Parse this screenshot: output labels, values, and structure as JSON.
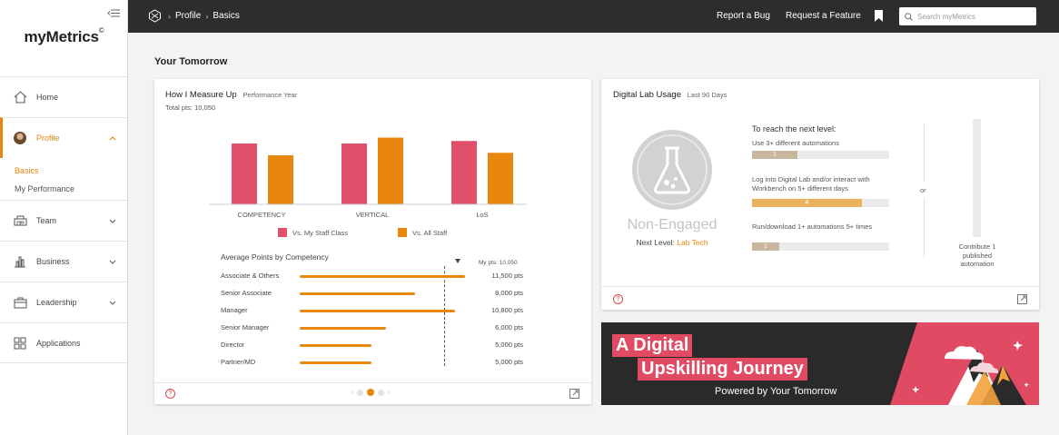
{
  "app": {
    "brand": "myMetrics",
    "brand_mark": "©"
  },
  "sidebar": {
    "collapse_icon": "collapse-menu-icon",
    "items": [
      {
        "label": "Home",
        "icon": "home-icon"
      },
      {
        "label": "Profile",
        "icon": "avatar"
      },
      {
        "label": "Team",
        "icon": "team-icon"
      },
      {
        "label": "Business",
        "icon": "chart-icon"
      },
      {
        "label": "Leadership",
        "icon": "briefcase-icon"
      },
      {
        "label": "Applications",
        "icon": "grid-icon"
      }
    ],
    "sub_items": [
      "Basics",
      "My Performance"
    ]
  },
  "topbar": {
    "breadcrumbs": [
      "Profile",
      "Basics"
    ],
    "report_bug": "Report a Bug",
    "request_feature": "Request a Feature",
    "search_placeholder": "Search myMetrics"
  },
  "page": {
    "title": "Your Tomorrow"
  },
  "measure_card": {
    "title": "How I Measure Up",
    "subtitle": "Performance Year",
    "total": "Total pts: 10,050",
    "legend": [
      "Vs. My Staff Class",
      "Vs. All Staff"
    ],
    "competency_title": "Average Points by Competency",
    "my_pts_label": "My pts: 10,050",
    "my_pts_value": 10050,
    "rows": [
      {
        "label": "Associate & Others",
        "value_text": "11,500 pts",
        "value": 11500
      },
      {
        "label": "Senior Associate",
        "value_text": "8,000 pts",
        "value": 8000
      },
      {
        "label": "Manager",
        "value_text": "10,800 pts",
        "value": 10800
      },
      {
        "label": "Senior Manager",
        "value_text": "6,000 pts",
        "value": 6000
      },
      {
        "label": "Director",
        "value_text": "5,000 pts",
        "value": 5000
      },
      {
        "label": "Partner/MD",
        "value_text": "5,000 pts",
        "value": 5000
      }
    ],
    "pager_prev": "‹",
    "pager_next": "›"
  },
  "chart_data": {
    "type": "bar",
    "categories": [
      "COMPETENCY",
      "VERTICAL",
      "LoS"
    ],
    "series": [
      {
        "name": "Vs. My Staff Class",
        "color": "#e0506a",
        "values": [
          72,
          72,
          75
        ]
      },
      {
        "name": "Vs. All Staff",
        "color": "#e8860d",
        "values": [
          58,
          79,
          61
        ]
      }
    ],
    "ylim": [
      0,
      100
    ],
    "grid": false,
    "legend": "bottom"
  },
  "lab_card": {
    "title": "Digital Lab Usage",
    "subtitle": "Last 90 Days",
    "status": "Non-Engaged",
    "next_level_label": "Next Level: ",
    "next_level_value": "Lab Tech",
    "reach_title": "To reach the next level:",
    "requirements": [
      {
        "text": "Use 3+ different automations",
        "value": "1",
        "fraction": 0.33,
        "color": "#c8b79e"
      },
      {
        "text": "Log into Digital Lab and/or interact with Workbench on 5+ different days",
        "value": "4",
        "fraction": 0.8,
        "color": "#e9b25e"
      },
      {
        "text": "Run/download 1+ automations 5+ times",
        "value": "1",
        "fraction": 0.2,
        "color": "#c8b79e"
      }
    ],
    "or_text": "or",
    "publish_text": "Contribute 1 published automation"
  },
  "banner": {
    "line1": "A Digital",
    "line2": "Upskilling Journey",
    "powered": "Powered by Your Tomorrow",
    "accent": "#e04b63"
  },
  "colors": {
    "accent": "#e8860d",
    "topbar": "#2d2d2d"
  }
}
